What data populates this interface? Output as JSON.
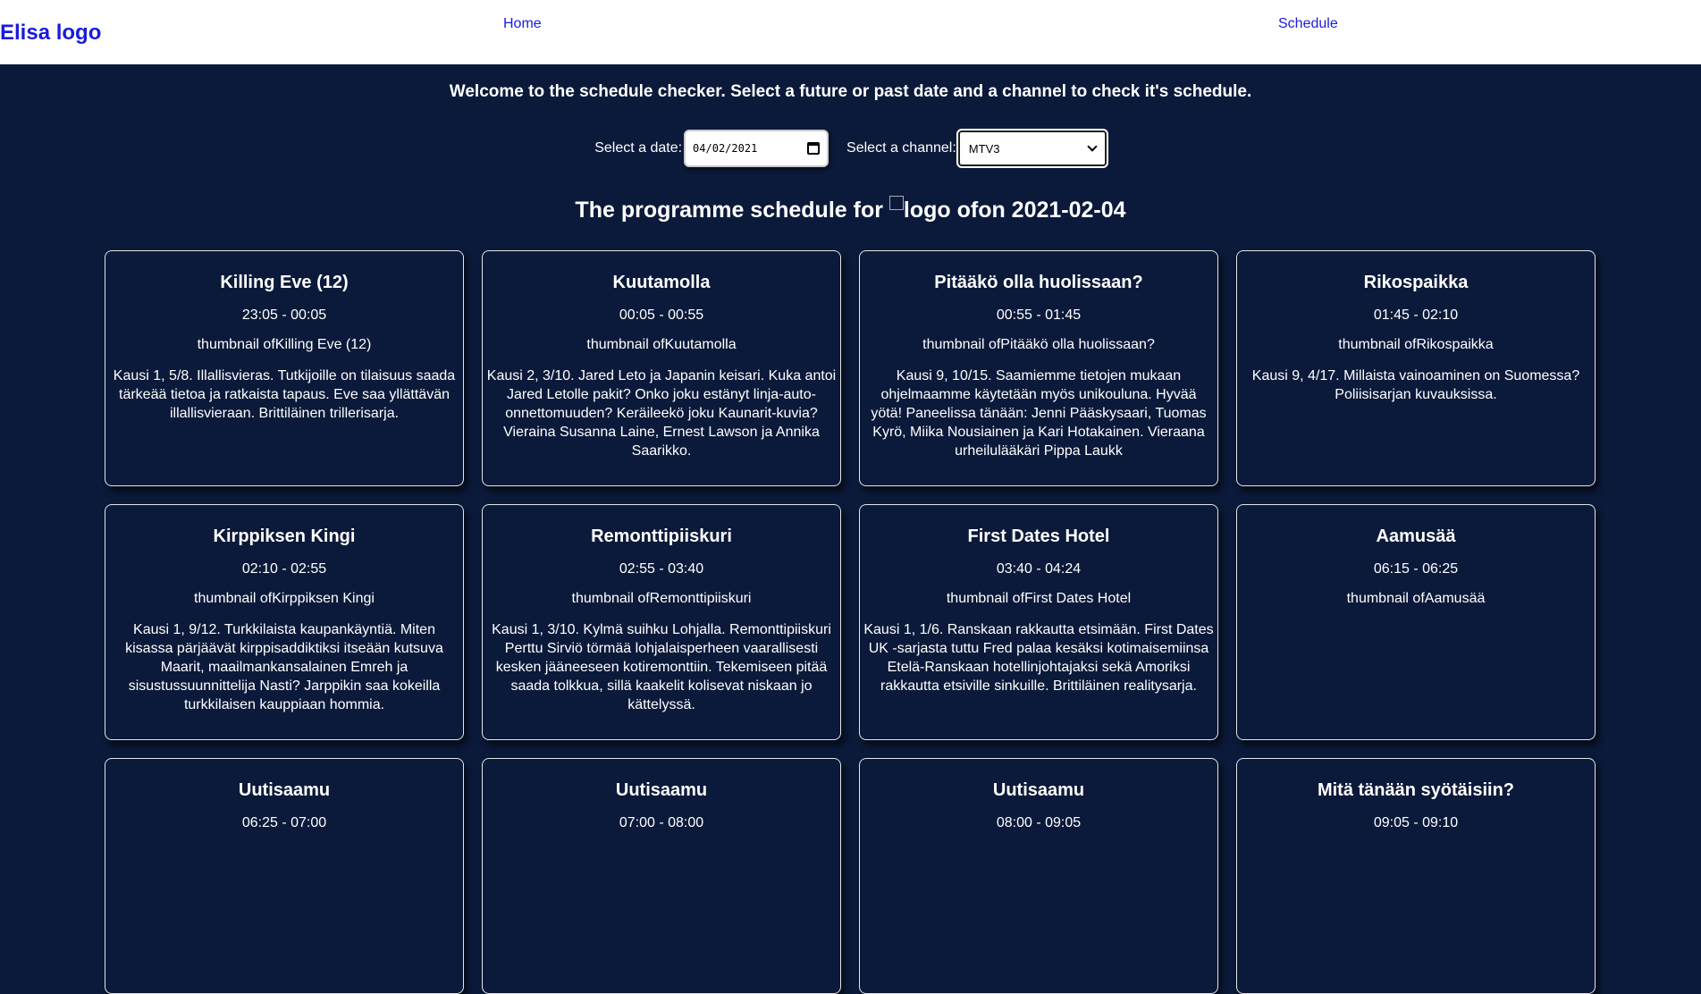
{
  "header": {
    "logo_text": "Elisa logo",
    "nav": {
      "home": "Home",
      "schedule": "Schedule"
    }
  },
  "welcome_text": "Welcome to the schedule checker. Select a future or past date and a channel to check it's schedule.",
  "controls": {
    "date_label": "Select a date:",
    "date_value": "04/02/2021",
    "channel_label": "Select a channel:",
    "channel_value": "MTV3"
  },
  "schedule_title": {
    "prefix": "The programme schedule for ",
    "suffix": "logo ofon 2021-02-04"
  },
  "programmes": [
    {
      "title": "Killing Eve (12)",
      "time": "23:05 - 00:05",
      "thumb_alt": "thumbnail ofKilling Eve (12)",
      "description": "Kausi 1, 5/8. Illallisvieras. Tutkijoille on tilaisuus saada tärkeää tietoa ja ratkaista tapaus. Eve saa yllättävän illallisvieraan. Brittiläinen trillerisarja."
    },
    {
      "title": "Kuutamolla",
      "time": "00:05 - 00:55",
      "thumb_alt": "thumbnail ofKuutamolla",
      "description": "Kausi 2, 3/10. Jared Leto ja Japanin keisari. Kuka antoi Jared Letolle pakit? Onko joku estänyt linja-auto-onnettomuuden? Keräileekö joku Kaunarit-kuvia? Vieraina Susanna Laine, Ernest Lawson ja Annika Saarikko."
    },
    {
      "title": "Pitääkö olla huolissaan?",
      "time": "00:55 - 01:45",
      "thumb_alt": "thumbnail ofPitääkö olla huolissaan?",
      "description": "Kausi 9, 10/15. Saamiemme tietojen mukaan ohjelmaamme käytetään myös unikouluna. Hyvää yötä! Paneelissa tänään: Jenni Pääskysaari, Tuomas Kyrö, Miika Nousiainen ja Kari Hotakainen. Vieraana urheilulääkäri Pippa Laukk"
    },
    {
      "title": "Rikospaikka",
      "time": "01:45 - 02:10",
      "thumb_alt": "thumbnail ofRikospaikka",
      "description": "Kausi 9, 4/17. Millaista vainoaminen on Suomessa? Poliisisarjan kuvauksissa."
    },
    {
      "title": "Kirppiksen Kingi",
      "time": "02:10 - 02:55",
      "thumb_alt": "thumbnail ofKirppiksen Kingi",
      "description": "Kausi 1, 9/12. Turkkilaista kaupankäyntiä. Miten kisassa pärjäävät kirppisaddiktiksi itseään kutsuva Maarit, maailmankansalainen Emreh ja sisustussuunnittelija Nasti? Jarppikin saa kokeilla turkkilaisen kauppiaan hommia."
    },
    {
      "title": "Remonttipiiskuri",
      "time": "02:55 - 03:40",
      "thumb_alt": "thumbnail ofRemonttipiiskuri",
      "description": "Kausi 1, 3/10. Kylmä suihku Lohjalla. Remonttipiiskuri Perttu Sirviö törmää lohjalaisperheen vaarallisesti kesken jääneeseen kotiremonttiin. Tekemiseen pitää saada tolkkua, sillä kaakelit kolisevat niskaan jo kättelyssä."
    },
    {
      "title": "First Dates Hotel",
      "time": "03:40 - 04:24",
      "thumb_alt": "thumbnail ofFirst Dates Hotel",
      "description": "Kausi 1, 1/6. Ranskaan rakkautta etsimään. First Dates UK -sarjasta tuttu Fred palaa kesäksi kotimaisemiinsa Etelä-Ranskaan hotellinjohtajaksi sekä Amoriksi rakkautta etsiville sinkuille. Brittiläinen realitysarja."
    },
    {
      "title": "Aamusää",
      "time": "06:15 - 06:25",
      "thumb_alt": "thumbnail ofAamusää",
      "description": ""
    },
    {
      "title": "Uutisaamu",
      "time": "06:25 - 07:00",
      "thumb_alt": "",
      "description": ""
    },
    {
      "title": "Uutisaamu",
      "time": "07:00 - 08:00",
      "thumb_alt": "",
      "description": ""
    },
    {
      "title": "Uutisaamu",
      "time": "08:00 - 09:05",
      "thumb_alt": "",
      "description": ""
    },
    {
      "title": "Mitä tänään syötäisiin?",
      "time": "09:05 - 09:10",
      "thumb_alt": "",
      "description": ""
    }
  ],
  "colors": {
    "background": "#0b1a3a",
    "header": "#ffffff",
    "link": "#1a1adf"
  },
  "icons": {
    "date": "calendar-icon",
    "channel": "chevron-down-icon",
    "broken_image": "broken-image-icon"
  }
}
